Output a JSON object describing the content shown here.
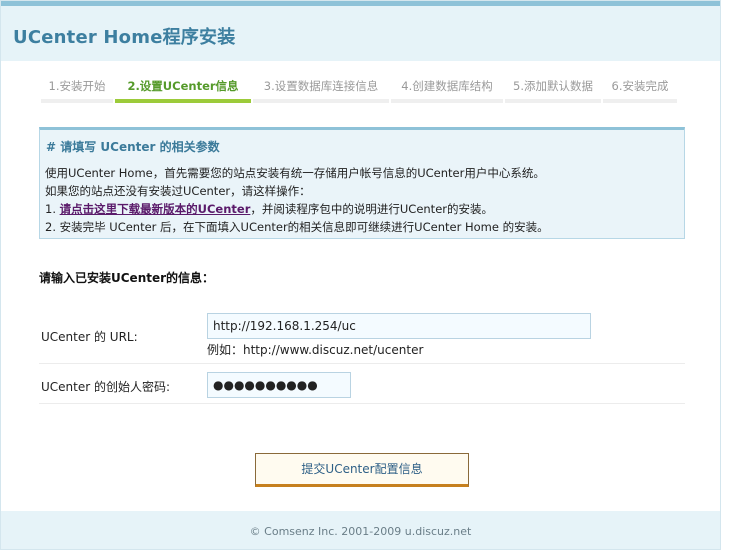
{
  "header": {
    "title": "UCenter Home程序安装"
  },
  "steps": [
    {
      "label": "1.安装开始",
      "active": false
    },
    {
      "label": "2.设置UCenter信息",
      "active": true
    },
    {
      "label": "3.设置数据库连接信息",
      "active": false
    },
    {
      "label": "4.创建数据库结构",
      "active": false
    },
    {
      "label": "5.添加默认数据",
      "active": false
    },
    {
      "label": "6.安装完成",
      "active": false
    }
  ],
  "notice": {
    "title": "# 请填写 UCenter 的相关参数",
    "line1": "使用UCenter Home，首先需要您的站点安装有统一存储用户帐号信息的UCenter用户中心系统。",
    "line2": "如果您的站点还没有安装过UCenter，请这样操作：",
    "line3_prefix": "1. ",
    "line3_link": "请点击这里下载最新版本的UCenter",
    "line3_suffix": "，并阅读程序包中的说明进行UCenter的安装。",
    "line4": "2. 安装完毕 UCenter 后，在下面填入UCenter的相关信息即可继续进行UCenter Home 的安装。"
  },
  "form": {
    "section_title": "请输入已安装UCenter的信息：",
    "url_label": "UCenter 的 URL:",
    "url_value": "http://192.168.1.254/uc",
    "url_hint": "例如：http://www.discuz.net/ucenter",
    "password_label": "UCenter 的创始人密码:",
    "password_value": "●●●●●●●●●●",
    "submit_label": "提交UCenter配置信息"
  },
  "footer": {
    "text": "© Comsenz Inc. 2001-2009 u.discuz.net"
  },
  "colors": {
    "accent": "#3d7fa0",
    "active_step": "#559a2a",
    "header_bg": "#e6f3f8",
    "link": "#5a1a6a",
    "button_border": "#c6801e"
  }
}
